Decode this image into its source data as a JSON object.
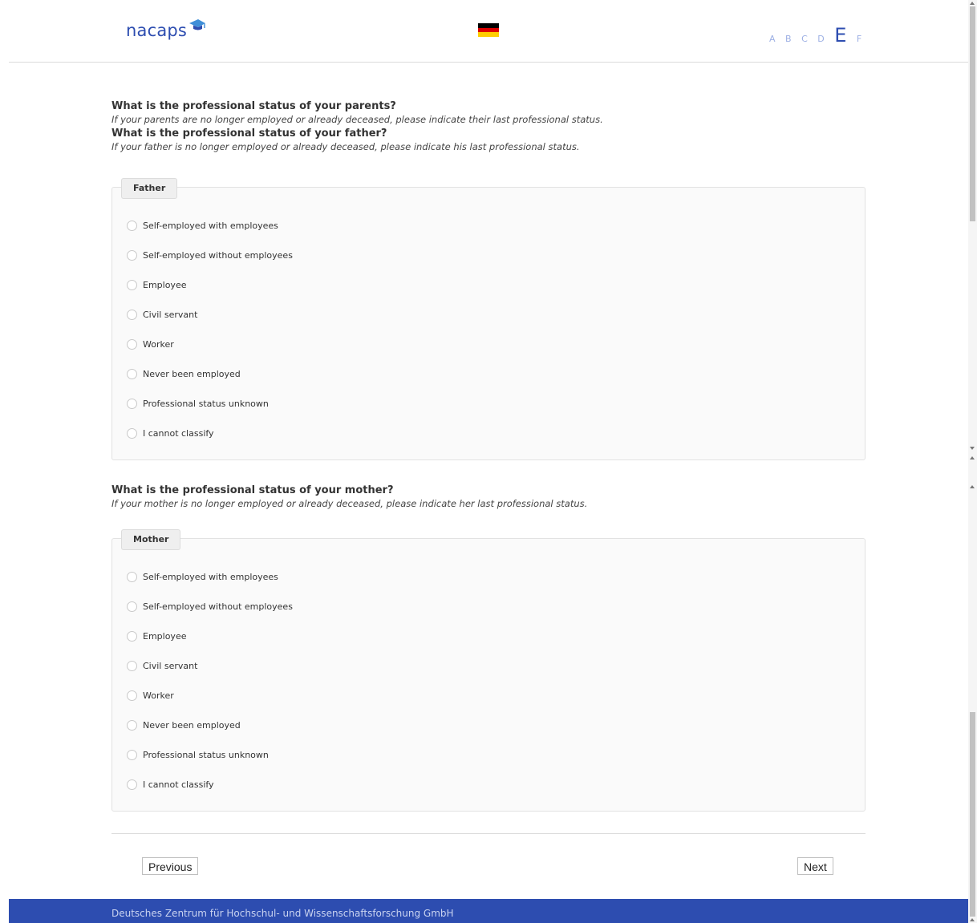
{
  "header": {
    "logo_text": "nacaps",
    "language_flag": "german-flag-icon",
    "progress_letters": [
      "A",
      "B",
      "C",
      "D",
      "E",
      "F"
    ],
    "active_letter": "E"
  },
  "questions": {
    "parents_title": "What is the professional status of your parents?",
    "parents_hint": "If your parents are no longer employed or already deceased, please indicate their last professional status.",
    "father_title": "What is the professional status of your father?",
    "father_hint": "If your father is no longer employed or already deceased, please indicate his last professional status.",
    "mother_title": "What is the professional status of your mother?",
    "mother_hint": "If your mother is no longer employed or already deceased, please indicate her last professional status."
  },
  "father": {
    "legend": "Father",
    "options": [
      "Self-employed with employees",
      "Self-employed without employees",
      "Employee",
      "Civil servant",
      "Worker",
      "Never been employed",
      "Professional status unknown",
      "I cannot classify"
    ]
  },
  "mother": {
    "legend": "Mother",
    "options": [
      "Self-employed with employees",
      "Self-employed without employees",
      "Employee",
      "Civil servant",
      "Worker",
      "Never been employed",
      "Professional status unknown",
      "I cannot classify"
    ]
  },
  "navigation": {
    "previous_label": "Previous",
    "next_label": "Next"
  },
  "footer": {
    "text": "Deutsches Zentrum für Hochschul- und Wissenschaftsforschung GmbH"
  },
  "colors": {
    "brand_blue": "#2d4db0",
    "inactive_letter": "#9db0e4"
  }
}
